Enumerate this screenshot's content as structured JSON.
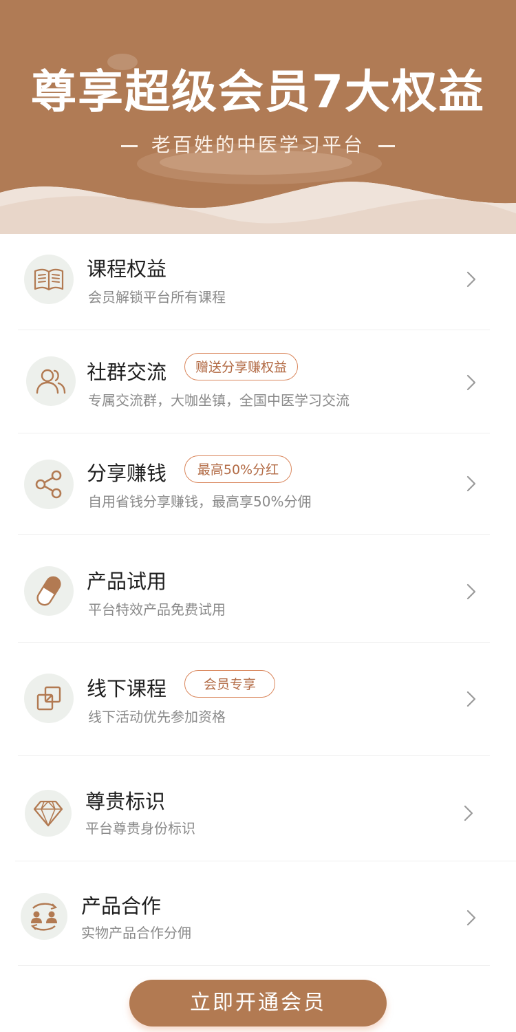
{
  "header": {
    "title": "尊享超级会员7大权益",
    "subtitle": "老百姓的中医学习平台"
  },
  "colors": {
    "brand": "#b27a52",
    "tag_border": "#d9855a",
    "icon_bg": "#edf0ec"
  },
  "benefits": [
    {
      "name": "课程权益",
      "desc": "会员解锁平台所有课程",
      "tag": "",
      "icon": "book-icon"
    },
    {
      "name": "社群交流",
      "desc": "专属交流群，大咖坐镇，全国中医学习交流",
      "tag": "赠送分享赚权益",
      "icon": "users-icon"
    },
    {
      "name": "分享赚钱",
      "desc": "自用省钱分享赚钱，最高享50%分佣",
      "tag": "最高50%分红",
      "icon": "share-icon"
    },
    {
      "name": "产品试用",
      "desc": "平台特效产品免费试用",
      "tag": "",
      "icon": "capsule-icon"
    },
    {
      "name": "线下课程",
      "desc": "线下活动优先参加资格",
      "tag": "会员专享",
      "icon": "copy-squares-icon"
    },
    {
      "name": "尊贵标识",
      "desc": "平台尊贵身份标识",
      "tag": "",
      "icon": "diamond-icon"
    },
    {
      "name": "产品合作",
      "desc": "实物产品合作分佣",
      "tag": "",
      "icon": "partners-icon"
    }
  ],
  "cta": {
    "label": "立即开通会员"
  }
}
